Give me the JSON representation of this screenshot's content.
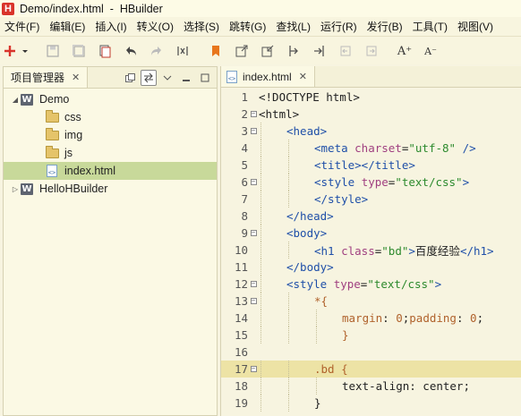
{
  "window": {
    "title": "Demo/index.html  -  HBuilder",
    "logo_letter": "H"
  },
  "menu": [
    "文件(F)",
    "编辑(E)",
    "插入(I)",
    "转义(O)",
    "选择(S)",
    "跳转(G)",
    "查找(L)",
    "运行(R)",
    "发行(B)",
    "工具(T)",
    "视图(V)"
  ],
  "toolbar": {
    "icons": [
      "new-icon",
      "save-icon",
      "save-all-icon",
      "copy-icon",
      "undo-icon",
      "redo-icon",
      "format-icon",
      "bookmark-icon",
      "export-icon",
      "import-icon",
      "step-in-icon",
      "step-out-icon",
      "back-icon",
      "forward-icon",
      "font-larger-icon",
      "font-smaller-icon"
    ],
    "font_larger": "A⁺",
    "font_smaller": "A⁻"
  },
  "project_panel": {
    "tab_label": "项目管理器",
    "tab_close": "✕",
    "tree": [
      {
        "label": "Demo",
        "type": "project",
        "level": 0,
        "expanded": true
      },
      {
        "label": "css",
        "type": "folder",
        "level": 1
      },
      {
        "label": "img",
        "type": "folder",
        "level": 1
      },
      {
        "label": "js",
        "type": "folder",
        "level": 1
      },
      {
        "label": "index.html",
        "type": "file",
        "level": 1,
        "selected": true
      },
      {
        "label": "HelloHBuilder",
        "type": "project",
        "level": 0,
        "expanded": false
      }
    ]
  },
  "editor": {
    "tab_label": "index.html",
    "tab_close": "✕",
    "current_line": 17,
    "lines": [
      {
        "n": "1",
        "fold": "",
        "indent": 0,
        "tokens": [
          [
            "c-plain",
            "<!DOCTYPE html>"
          ]
        ]
      },
      {
        "n": "2",
        "fold": "−",
        "indent": 0,
        "tokens": [
          [
            "c-plain",
            "<html>"
          ]
        ]
      },
      {
        "n": "3",
        "fold": "−",
        "indent": 1,
        "tokens": [
          [
            "c-tag",
            "<head>"
          ]
        ]
      },
      {
        "n": "4",
        "fold": "",
        "indent": 2,
        "tokens": [
          [
            "c-tag",
            "<meta "
          ],
          [
            "c-attr",
            "charset"
          ],
          [
            "c-plain",
            "="
          ],
          [
            "c-str",
            "\"utf-8\""
          ],
          [
            "c-tag",
            " />"
          ]
        ]
      },
      {
        "n": "5",
        "fold": "",
        "indent": 2,
        "tokens": [
          [
            "c-tag",
            "<title></title>"
          ]
        ]
      },
      {
        "n": "6",
        "fold": "−",
        "indent": 2,
        "tokens": [
          [
            "c-tag",
            "<style "
          ],
          [
            "c-attr",
            "type"
          ],
          [
            "c-plain",
            "="
          ],
          [
            "c-str",
            "\"text/css\""
          ],
          [
            "c-tag",
            ">"
          ]
        ]
      },
      {
        "n": "7",
        "fold": "",
        "indent": 2,
        "tokens": [
          [
            "c-tag",
            "</style>"
          ]
        ]
      },
      {
        "n": "8",
        "fold": "",
        "indent": 1,
        "tokens": [
          [
            "c-tag",
            "</head>"
          ]
        ]
      },
      {
        "n": "9",
        "fold": "−",
        "indent": 1,
        "tokens": [
          [
            "c-tag",
            "<body>"
          ]
        ]
      },
      {
        "n": "10",
        "fold": "",
        "indent": 2,
        "tokens": [
          [
            "c-tag",
            "<h1 "
          ],
          [
            "c-attr",
            "class"
          ],
          [
            "c-plain",
            "="
          ],
          [
            "c-str",
            "\"bd\""
          ],
          [
            "c-tag",
            ">"
          ],
          [
            "c-plain",
            "百度经验"
          ],
          [
            "c-tag",
            "</h1>"
          ]
        ]
      },
      {
        "n": "11",
        "fold": "",
        "indent": 1,
        "tokens": [
          [
            "c-tag",
            "</body>"
          ]
        ]
      },
      {
        "n": "12",
        "fold": "−",
        "indent": 1,
        "tokens": [
          [
            "c-tag",
            "<style "
          ],
          [
            "c-attr",
            "type"
          ],
          [
            "c-plain",
            "="
          ],
          [
            "c-str",
            "\"text/css\""
          ],
          [
            "c-tag",
            ">"
          ]
        ]
      },
      {
        "n": "13",
        "fold": "−",
        "indent": 2,
        "tokens": [
          [
            "c-kw",
            "*{"
          ]
        ]
      },
      {
        "n": "14",
        "fold": "",
        "indent": 3,
        "tokens": [
          [
            "c-kw",
            "margin"
          ],
          [
            "c-plain",
            ": "
          ],
          [
            "c-num",
            "0"
          ],
          [
            "c-plain",
            ";"
          ],
          [
            "c-kw",
            "padding"
          ],
          [
            "c-plain",
            ": "
          ],
          [
            "c-num",
            "0"
          ],
          [
            "c-plain",
            ";"
          ]
        ]
      },
      {
        "n": "15",
        "fold": "",
        "indent": 3,
        "tokens": [
          [
            "c-kw",
            "}"
          ]
        ]
      },
      {
        "n": "16",
        "fold": "",
        "indent": 0,
        "tokens": []
      },
      {
        "n": "17",
        "fold": "−",
        "indent": 2,
        "tokens": [
          [
            "c-kw",
            ".bd "
          ],
          [
            "c-kw",
            "{"
          ]
        ]
      },
      {
        "n": "18",
        "fold": "",
        "indent": 3,
        "tokens": [
          [
            "c-plain",
            "text-align: center;"
          ]
        ]
      },
      {
        "n": "19",
        "fold": "",
        "indent": 2,
        "tokens": [
          [
            "c-plain",
            "}"
          ]
        ]
      }
    ]
  }
}
